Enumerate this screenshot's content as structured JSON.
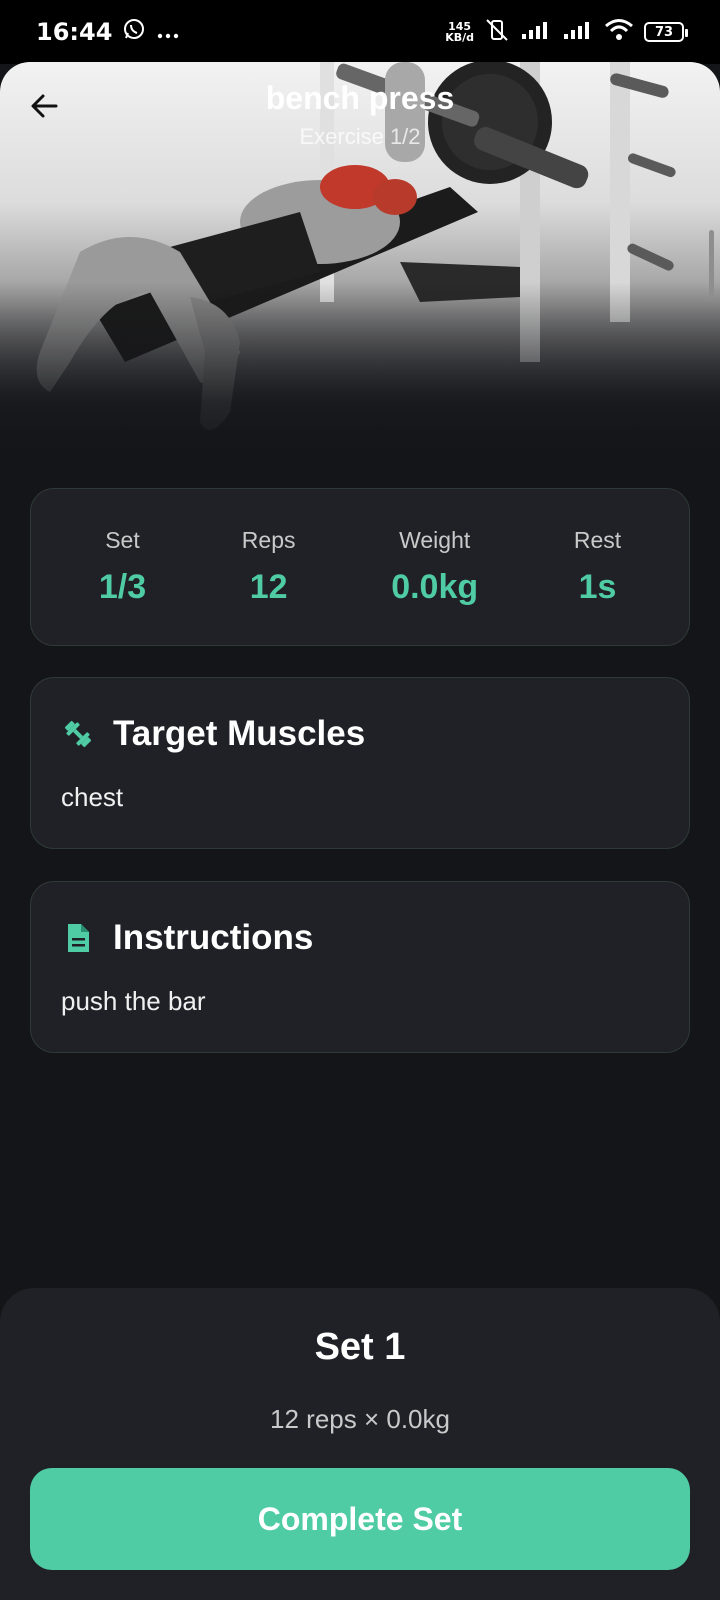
{
  "status_bar": {
    "time": "16:44",
    "net_speed_value": "145",
    "net_speed_unit": "KB/d",
    "battery": "73"
  },
  "header": {
    "title": "bench press",
    "subtitle": "Exercise 1/2"
  },
  "stats": [
    {
      "label": "Set",
      "value": "1/3"
    },
    {
      "label": "Reps",
      "value": "12"
    },
    {
      "label": "Weight",
      "value": "0.0kg"
    },
    {
      "label": "Rest",
      "value": "1s"
    }
  ],
  "target_muscles": {
    "title": "Target Muscles",
    "body": "chest",
    "icon": "dumbbell-icon"
  },
  "instructions": {
    "title": "Instructions",
    "body": "push the bar",
    "icon": "document-icon"
  },
  "current_set": {
    "title": "Set 1",
    "detail": "12 reps × 0.0kg",
    "button_label": "Complete Set"
  },
  "colors": {
    "accent": "#4fcca3",
    "background": "#141518",
    "card": "#1f2127"
  }
}
